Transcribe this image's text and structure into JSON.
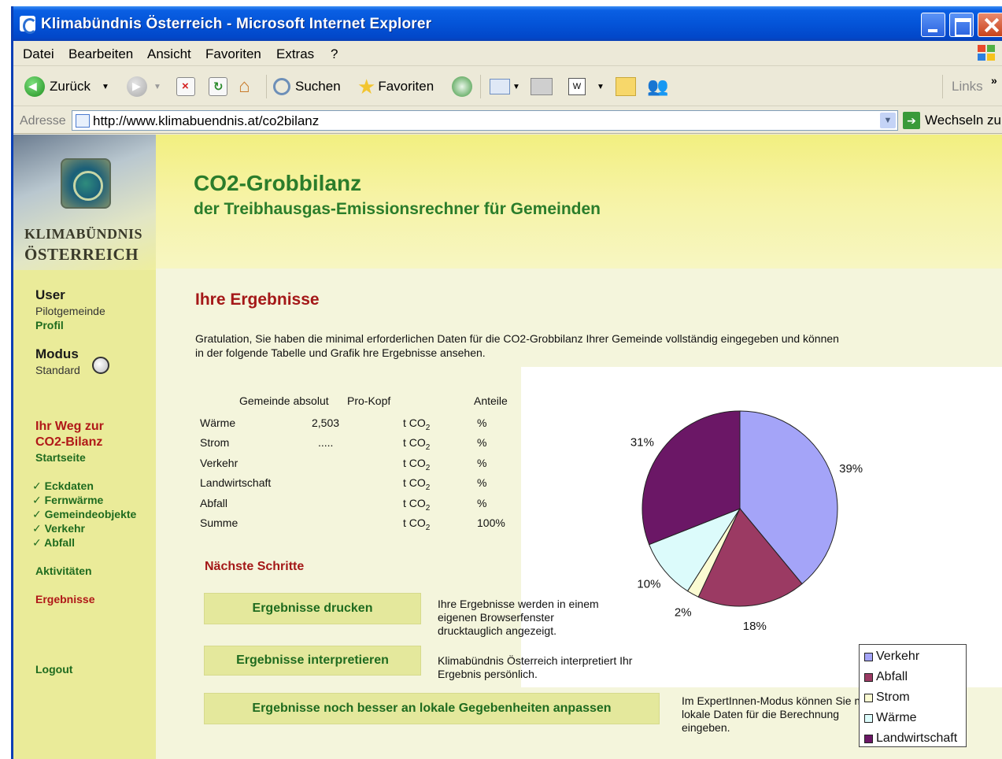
{
  "window": {
    "title": "Klimabündnis Österreich - Microsoft Internet Explorer"
  },
  "menubar": {
    "items": [
      "Datei",
      "Bearbeiten",
      "Ansicht",
      "Favoriten",
      "Extras",
      "?"
    ]
  },
  "toolbar": {
    "back_label": "Zurück",
    "search_label": "Suchen",
    "favorites_label": "Favoriten",
    "links_label": "Links",
    "chevron": "»"
  },
  "address": {
    "label": "Adresse",
    "url": "http://www.klimabuendnis.at/co2bilanz",
    "go_label": "Wechseln zu"
  },
  "logo": {
    "line1": "KLIMABÜNDNIS",
    "line2": "ÖSTERREICH"
  },
  "header": {
    "title": "CO2-Grobbilanz",
    "subtitle": "der Treibhausgas-Emissionsrechner für Gemeinden"
  },
  "sidebar": {
    "user_heading": "User",
    "user_name": "Pilotgemeinde",
    "profile_link": "Profil",
    "mode_heading": "Modus",
    "mode_value": "Standard",
    "path_heading_1": "Ihr Weg zur",
    "path_heading_2": "CO2-Bilanz",
    "start_link": "Startseite",
    "steps": [
      "✓ Eckdaten",
      "✓ Fernwärme",
      "✓ Gemeindeobjekte",
      "✓ Verkehr",
      "✓ Abfall"
    ],
    "activities_link": "Aktivitäten",
    "results_link": "Ergebnisse",
    "logout_link": "Logout"
  },
  "main": {
    "heading": "Ihre Ergebnisse",
    "intro": "Gratulation, Sie haben die minimal erforderlichen Daten für die CO2-Grobbilanz Ihrer Gemeinde vollständig eingegeben und können in der folgende Tabelle und Grafik hre Ergebnisse ansehen.",
    "table": {
      "headers": [
        "Gemeinde absolut",
        "Pro-Kopf",
        "Anteile"
      ],
      "unit_prefix": "t CO",
      "unit_sub": "2",
      "rows": [
        {
          "label": "Wärme",
          "absolut": "2,503",
          "share": "%"
        },
        {
          "label": "Strom",
          "absolut": ".....",
          "share": "%"
        },
        {
          "label": "Verkehr",
          "absolut": "",
          "share": "%"
        },
        {
          "label": "Landwirtschaft",
          "absolut": "",
          "share": "%"
        },
        {
          "label": "Abfall",
          "absolut": "",
          "share": "%"
        },
        {
          "label": "Summe",
          "absolut": "",
          "share": "100%"
        }
      ]
    },
    "next_heading": "Nächste Schritte",
    "actions": [
      {
        "label": "Ergebnisse drucken",
        "note": "Ihre Ergebnisse werden in einem eigenen Browserfenster drucktauglich angezeigt."
      },
      {
        "label": "Ergebnisse interpretieren",
        "note": "Klimabündnis Österreich interpretiert Ihr Ergebnis persönlich."
      },
      {
        "label": "Ergebnisse noch besser an lokale Gegebenheiten anpassen",
        "note": "Im ExpertInnen-Modus können Sie mehr lokale Daten für die Berechnung eingeben."
      }
    ]
  },
  "chart_data": {
    "type": "pie",
    "slices": [
      {
        "name": "Verkehr",
        "value": 39,
        "label": "39%",
        "color": "#a4a4f8"
      },
      {
        "name": "Abfall",
        "value": 18,
        "label": "18%",
        "color": "#9b3a63"
      },
      {
        "name": "Strom",
        "value": 2,
        "label": "2%",
        "color": "#fbfbd2"
      },
      {
        "name": "Wärme",
        "value": 10,
        "label": "10%",
        "color": "#dcfbfb"
      },
      {
        "name": "Landwirtschaft",
        "value": 31,
        "label": "31%",
        "color": "#6b1766"
      }
    ],
    "legend": [
      "Verkehr",
      "Abfall",
      "Strom",
      "Wärme",
      "Landwirtschaft"
    ],
    "legend_position": "right"
  }
}
